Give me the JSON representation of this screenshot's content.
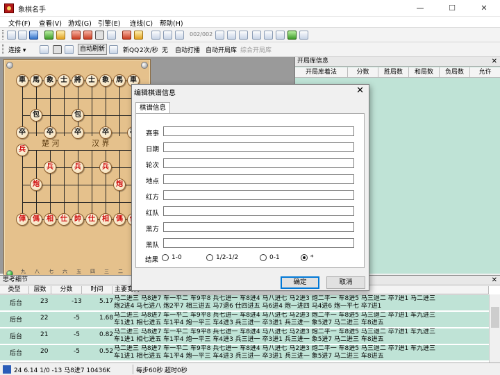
{
  "window": {
    "title": "象棋名手",
    "minimize": "—",
    "maximize": "☐",
    "close": "✕"
  },
  "menu": [
    "文件(F)",
    "查看(V)",
    "游戏(G)",
    "引擎(E)",
    "连线(C)",
    "帮助(H)"
  ],
  "toolbar": {
    "counter": "002/002",
    "connect": "连接",
    "auto_refresh": "自动刷新",
    "new_qq": "新QQ",
    "rate": "2次/秒",
    "none": "无",
    "auto_play": "自动打播",
    "auto_open": "自动开局库",
    "combined_open": "综合开局库"
  },
  "board": {
    "river_left": "楚 河",
    "river_right": "汉 界",
    "black_pieces": [
      "車",
      "馬",
      "象",
      "士",
      "將",
      "士",
      "象",
      "馬",
      "車",
      "包",
      "包",
      "卒",
      "卒",
      "卒",
      "卒",
      "卒"
    ],
    "red_pieces": [
      "兵",
      "兵",
      "兵",
      "兵",
      "炮",
      "炮",
      "俥",
      "傌",
      "相",
      "仕",
      "帥",
      "仕",
      "相",
      "傌",
      "俥"
    ],
    "file_numbers": [
      "九",
      "八",
      "七",
      "六",
      "五",
      "四",
      "三",
      "二",
      "一"
    ]
  },
  "opening_panel": {
    "title": "开局库信息",
    "columns": [
      "开局库着法",
      "分数",
      "胜局数",
      "和局数",
      "负局数",
      "允许"
    ]
  },
  "dialog": {
    "title": "编辑棋谱信息",
    "tab": "棋谱信息",
    "fields": [
      {
        "label": "赛事",
        "value": ""
      },
      {
        "label": "日期",
        "value": ""
      },
      {
        "label": "轮次",
        "value": ""
      },
      {
        "label": "地点",
        "value": ""
      },
      {
        "label": "红方",
        "value": ""
      },
      {
        "label": "红队",
        "value": ""
      },
      {
        "label": "黑方",
        "value": ""
      },
      {
        "label": "黑队",
        "value": ""
      }
    ],
    "result_label": "结果",
    "results": [
      "1-0",
      "1/2-1/2",
      "0-1",
      "*"
    ],
    "result_selected": "*",
    "ok": "确定",
    "cancel": "取消"
  },
  "analysis": {
    "title": "思考细节",
    "columns": [
      "类型",
      "层数",
      "分数",
      "时间",
      "主要变例"
    ],
    "rows": [
      {
        "type": "后台",
        "depth": "23",
        "score": "-13",
        "time": "5.17",
        "moves": "马二进三 马8进7 车一平二 车9平8 兵七进一 车8进4 马八进七 马2进3 炮二平一 车8进5 马三退二 卒7进1 马二进三\n炮2进4 马七进八 炮2平7 相三进五 马7退6 仕四进五 马6进4 炮一进四 马4进6 炮一平七 卒7进1"
      },
      {
        "type": "后台",
        "depth": "22",
        "score": "-5",
        "time": "1.68",
        "moves": "马二进三 马8进7 车一平二 车9平8 兵七进一 车8进4 马八进七 马2进3 炮二平一 车8进5 马三退二 卒7进1 车九进三\n车1进1 相七进五 车1平4 炮一平三 车4进3 兵三进一 卒3进1 兵三进一 象5进7 马二进三 车8进五"
      },
      {
        "type": "后台",
        "depth": "21",
        "score": "-5",
        "time": "0.82",
        "moves": "马二进三 马8进7 车一平二 车9平8 兵七进一 车8进4 马八进七 马2进3 炮二平一 车8进5 马三退二 卒7进1 车九进三\n车1进1 相七进五 车1平4 炮一平三 车4进3 兵三进一 卒3进1 兵三进一 象5进7 马二进三 车8进五"
      },
      {
        "type": "后台",
        "depth": "20",
        "score": "-5",
        "time": "0.52",
        "moves": "马二进三 马8进7 车一平二 车9平8 兵七进一 车8进4 马八进七 马2进3 炮二平一 车8进5 马三退二 卒7进1 车九进三\n车1进1 相七进五 车1平4 炮一平三 车4进3 兵三进一 卒3进1 兵三进一 象5进7 马二进三 车8进五"
      }
    ]
  },
  "status": {
    "left": "24 6.14 1/0 -13 马8进7 10436K",
    "time_per_move": "每步60秒",
    "timeout": "超时0秒"
  }
}
